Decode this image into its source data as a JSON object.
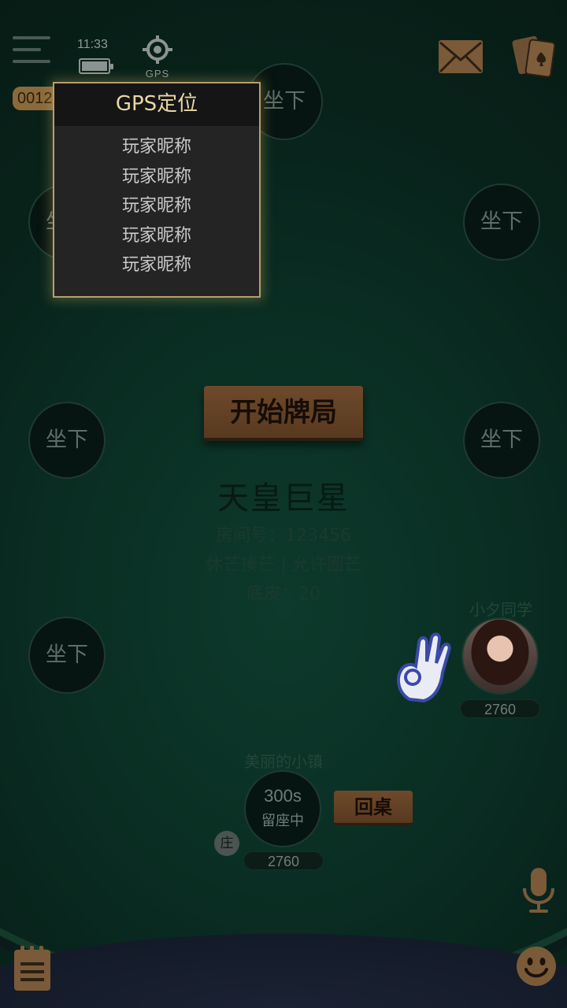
{
  "status": {
    "time": "11:33",
    "gps_label": "GPS",
    "room_code_partial": "0012"
  },
  "gps_popup": {
    "title": "GPS定位",
    "players": [
      "玩家昵称",
      "玩家昵称",
      "玩家昵称",
      "玩家昵称",
      "玩家昵称"
    ]
  },
  "seats": {
    "sit_label": "坐下"
  },
  "center": {
    "start_button": "开始牌局",
    "room_name": "天皇巨星",
    "room_number": "房间号：123456",
    "rules": "休芒揍芒 | 允许圈芒",
    "base": "底皮：20"
  },
  "opponent": {
    "name": "小夕同学",
    "score": "2760"
  },
  "self": {
    "name": "美丽的小镇",
    "timer": "300s",
    "status": "留座中",
    "score": "2760",
    "dealer_badge": "庄",
    "return_button": "回桌"
  },
  "colors": {
    "accent_gold": "#b79f6a",
    "felt": "#0a2e23",
    "button_brown": "#6e4a2b"
  },
  "icons": [
    "menu-icon",
    "battery-icon",
    "gps-icon",
    "mail-icon",
    "cards-icon",
    "ok-hand-icon",
    "mic-icon",
    "notes-icon",
    "smile-icon"
  ]
}
